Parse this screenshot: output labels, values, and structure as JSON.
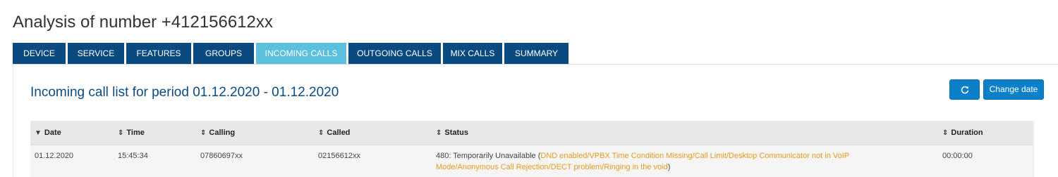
{
  "page": {
    "title": "Analysis of number +412156612xx"
  },
  "tabs": [
    {
      "label": "DEVICE",
      "active": false
    },
    {
      "label": "SERVICE",
      "active": false
    },
    {
      "label": "FEATURES",
      "active": false
    },
    {
      "label": "GROUPS",
      "active": false
    },
    {
      "label": "INCOMING CALLS",
      "active": true
    },
    {
      "label": "OUTGOING CALLS",
      "active": false
    },
    {
      "label": "MIX CALLS",
      "active": false
    },
    {
      "label": "SUMMARY",
      "active": false
    }
  ],
  "panel": {
    "title": "Incoming call list for period 01.12.2020 - 01.12.2020",
    "refresh_icon": "refresh-icon",
    "change_date_label": "Change date"
  },
  "table": {
    "columns": {
      "date": "Date",
      "time": "Time",
      "calling": "Calling",
      "called": "Called",
      "status": "Status",
      "duration": "Duration"
    },
    "sort_glyphs": {
      "active_desc": "▼",
      "sortable": "⇕"
    },
    "rows": [
      {
        "date": "01.12.2020",
        "time": "15:45:34",
        "calling": "07860697xx",
        "called": "02156612xx",
        "status_code": "480: Temporarily Unavailable (",
        "status_details": "DND enabled/VPBX Time Condition Missing/Call Limit/Desktop Communicator not in VoIP Mode/Anonymous Call Rejection/DECT problem/Ringing in the void",
        "status_close": ")",
        "duration": "00:00:00"
      }
    ]
  },
  "colors": {
    "tab_bg": "#0b4a80",
    "tab_active_bg": "#5bc0de",
    "button_bg": "#0b80c8",
    "title_accent": "#0b4a80",
    "status_detail": "#e69a1a"
  }
}
